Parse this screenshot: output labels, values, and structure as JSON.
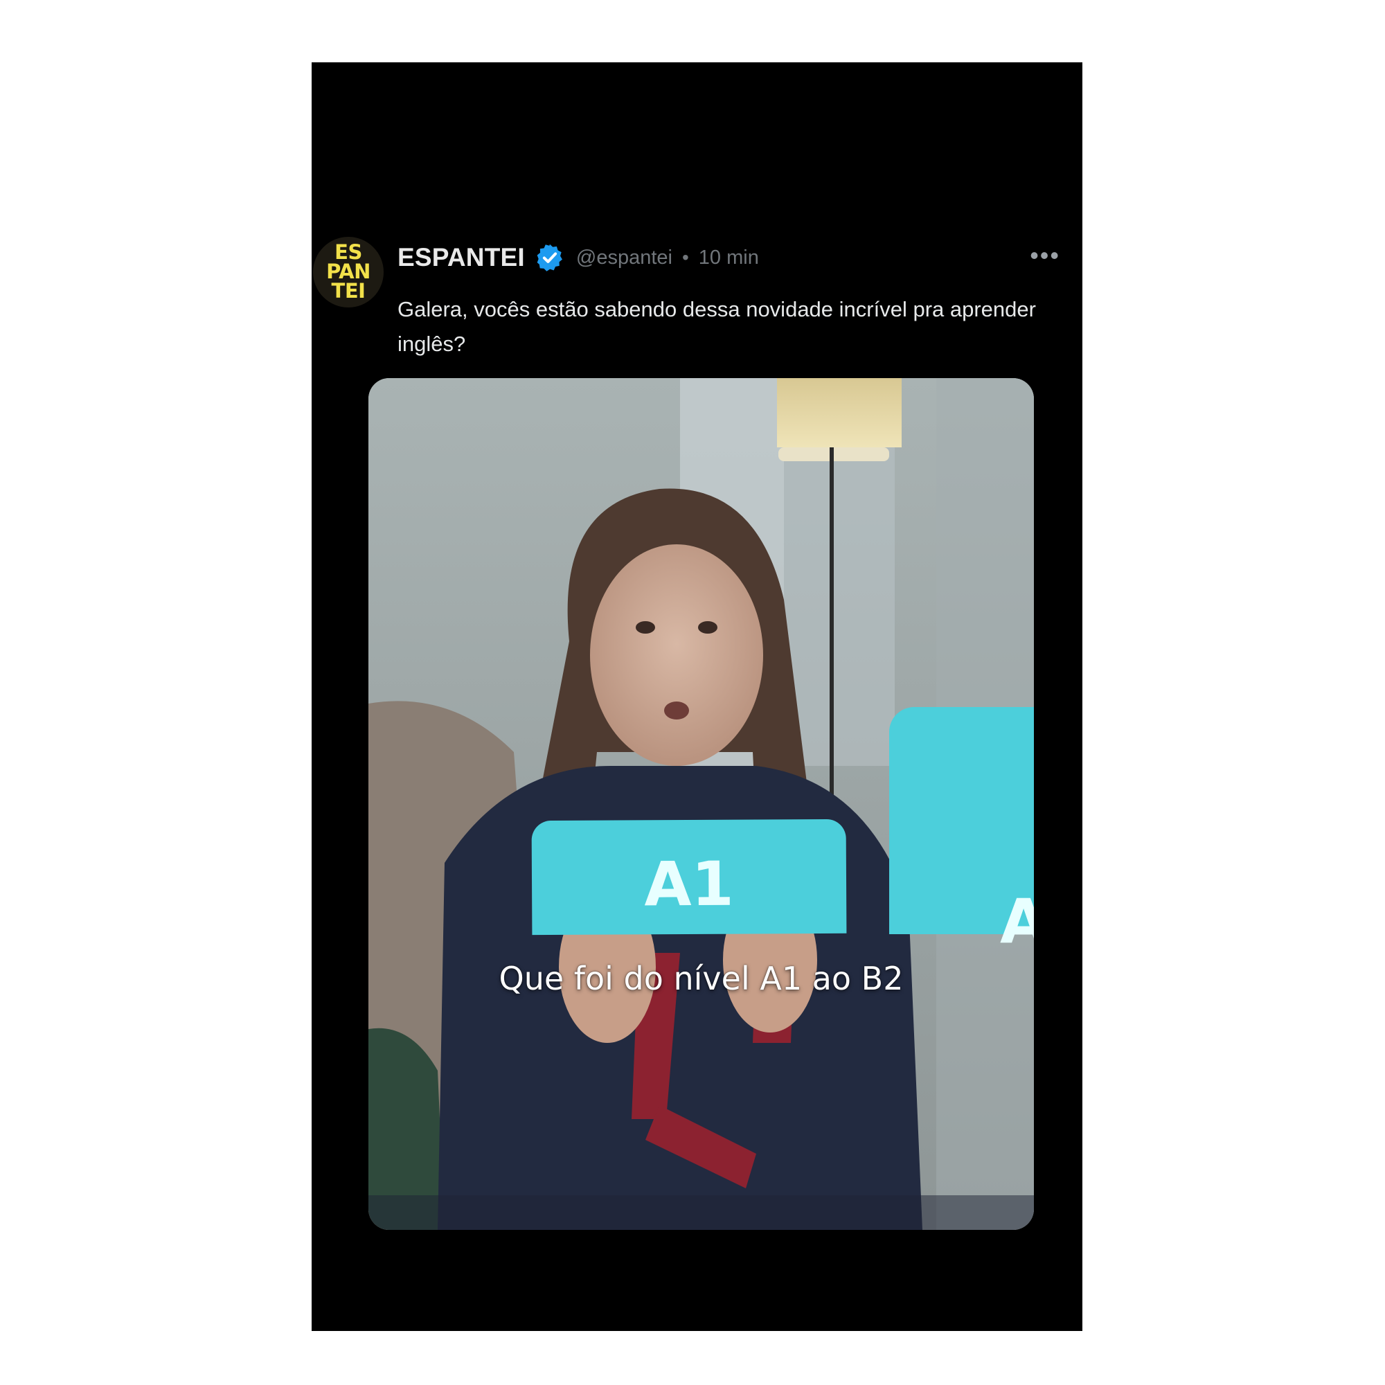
{
  "post": {
    "avatar_lines": [
      "ES",
      "PAN",
      "TEI"
    ],
    "display_name": "ESPANTEI",
    "verified_icon": "verified-badge-icon",
    "handle": "@espantei",
    "separator": "•",
    "timestamp": "10 min",
    "more_label": "•••",
    "text": "Galera, vocês estão sabendo dessa novidade incrível pra aprender inglês?"
  },
  "video": {
    "card_a1_label": "A1",
    "card_a2_label": "A",
    "caption": "Que foi do nível A1 ao B2"
  },
  "colors": {
    "background": "#000000",
    "accent_blue": "#1d9bf0",
    "avatar_text": "#f2e14a",
    "card_cyan": "#4ccfdb",
    "muted_text": "#71767b"
  }
}
